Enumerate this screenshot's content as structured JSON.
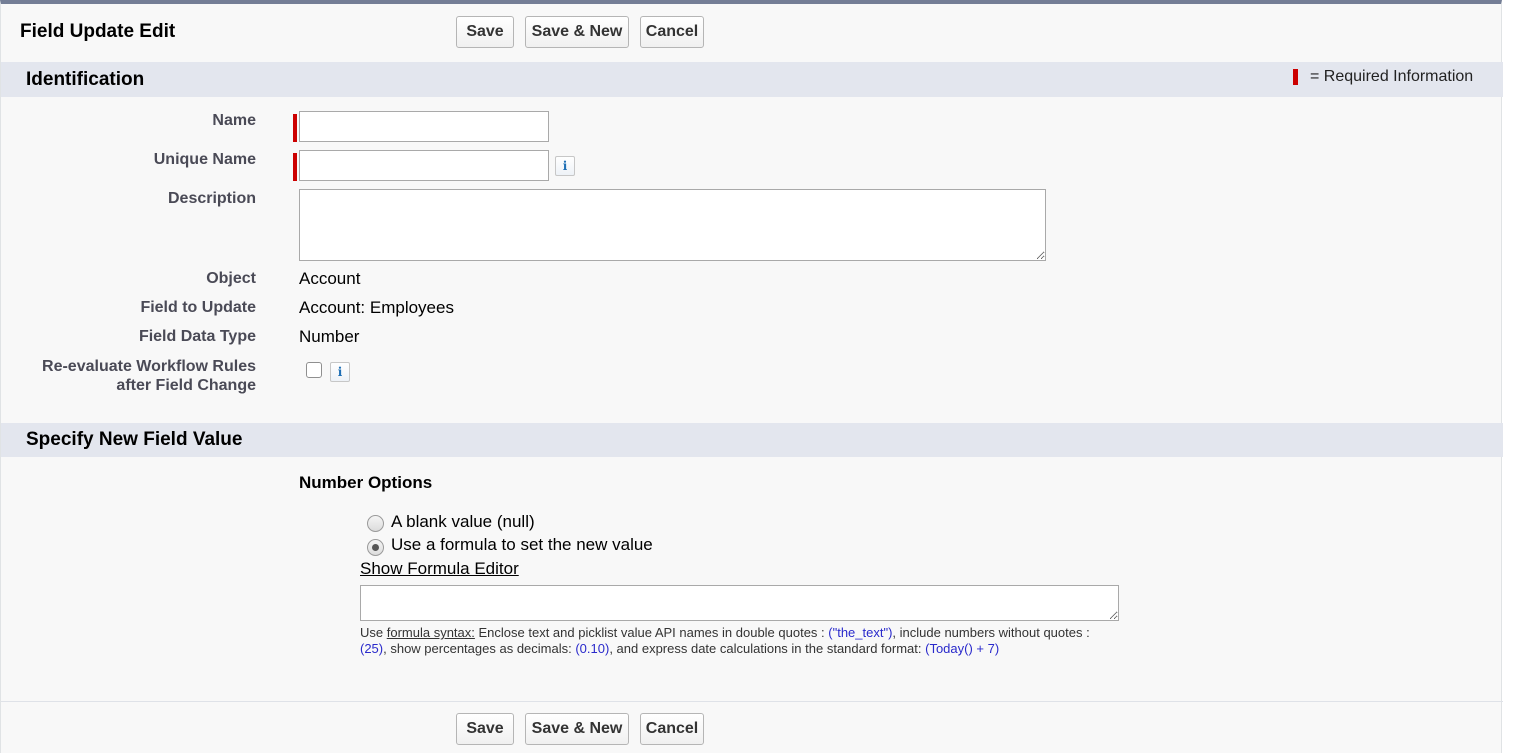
{
  "header": {
    "title": "Field Update Edit",
    "save_label": "Save",
    "save_new_label": "Save & New",
    "cancel_label": "Cancel"
  },
  "identification": {
    "title": "Identification",
    "required_legend": "= Required Information",
    "fields": {
      "name_label": "Name",
      "name_value": "",
      "unique_name_label": "Unique Name",
      "unique_name_value": "",
      "description_label": "Description",
      "description_value": "",
      "object_label": "Object",
      "object_value": "Account",
      "field_to_update_label": "Field to Update",
      "field_to_update_value": "Account: Employees",
      "field_data_type_label": "Field Data Type",
      "field_data_type_value": "Number",
      "reevaluate_label_line1": "Re-evaluate Workflow Rules",
      "reevaluate_label_line2": "after Field Change",
      "reevaluate_checked": false
    }
  },
  "new_value": {
    "title": "Specify New Field Value",
    "options_heading": "Number Options",
    "option_blank": "A blank value (null)",
    "option_formula": "Use a formula to set the new value",
    "selected_option": "formula",
    "formula_editor_link": "Show Formula Editor",
    "formula_value": "",
    "help": {
      "prefix": "Use ",
      "syntax_link": "formula syntax:",
      "part1": " Enclose text and picklist value API names in double quotes : ",
      "example_text": "(\"the_text\")",
      "part2": ", include numbers without quotes : ",
      "example_number": "(25)",
      "part3": ", show percentages as decimals: ",
      "example_percent": "(0.10)",
      "part4": ", and express date calculations in the standard format: ",
      "example_date": "(Today() + 7)"
    }
  },
  "footer": {
    "save_label": "Save",
    "save_new_label": "Save & New",
    "cancel_label": "Cancel"
  },
  "colors": {
    "required": "#cc0000",
    "section_bar": "#e3e6ee",
    "top_border": "#747e96",
    "code_example": "#2a2acb"
  }
}
